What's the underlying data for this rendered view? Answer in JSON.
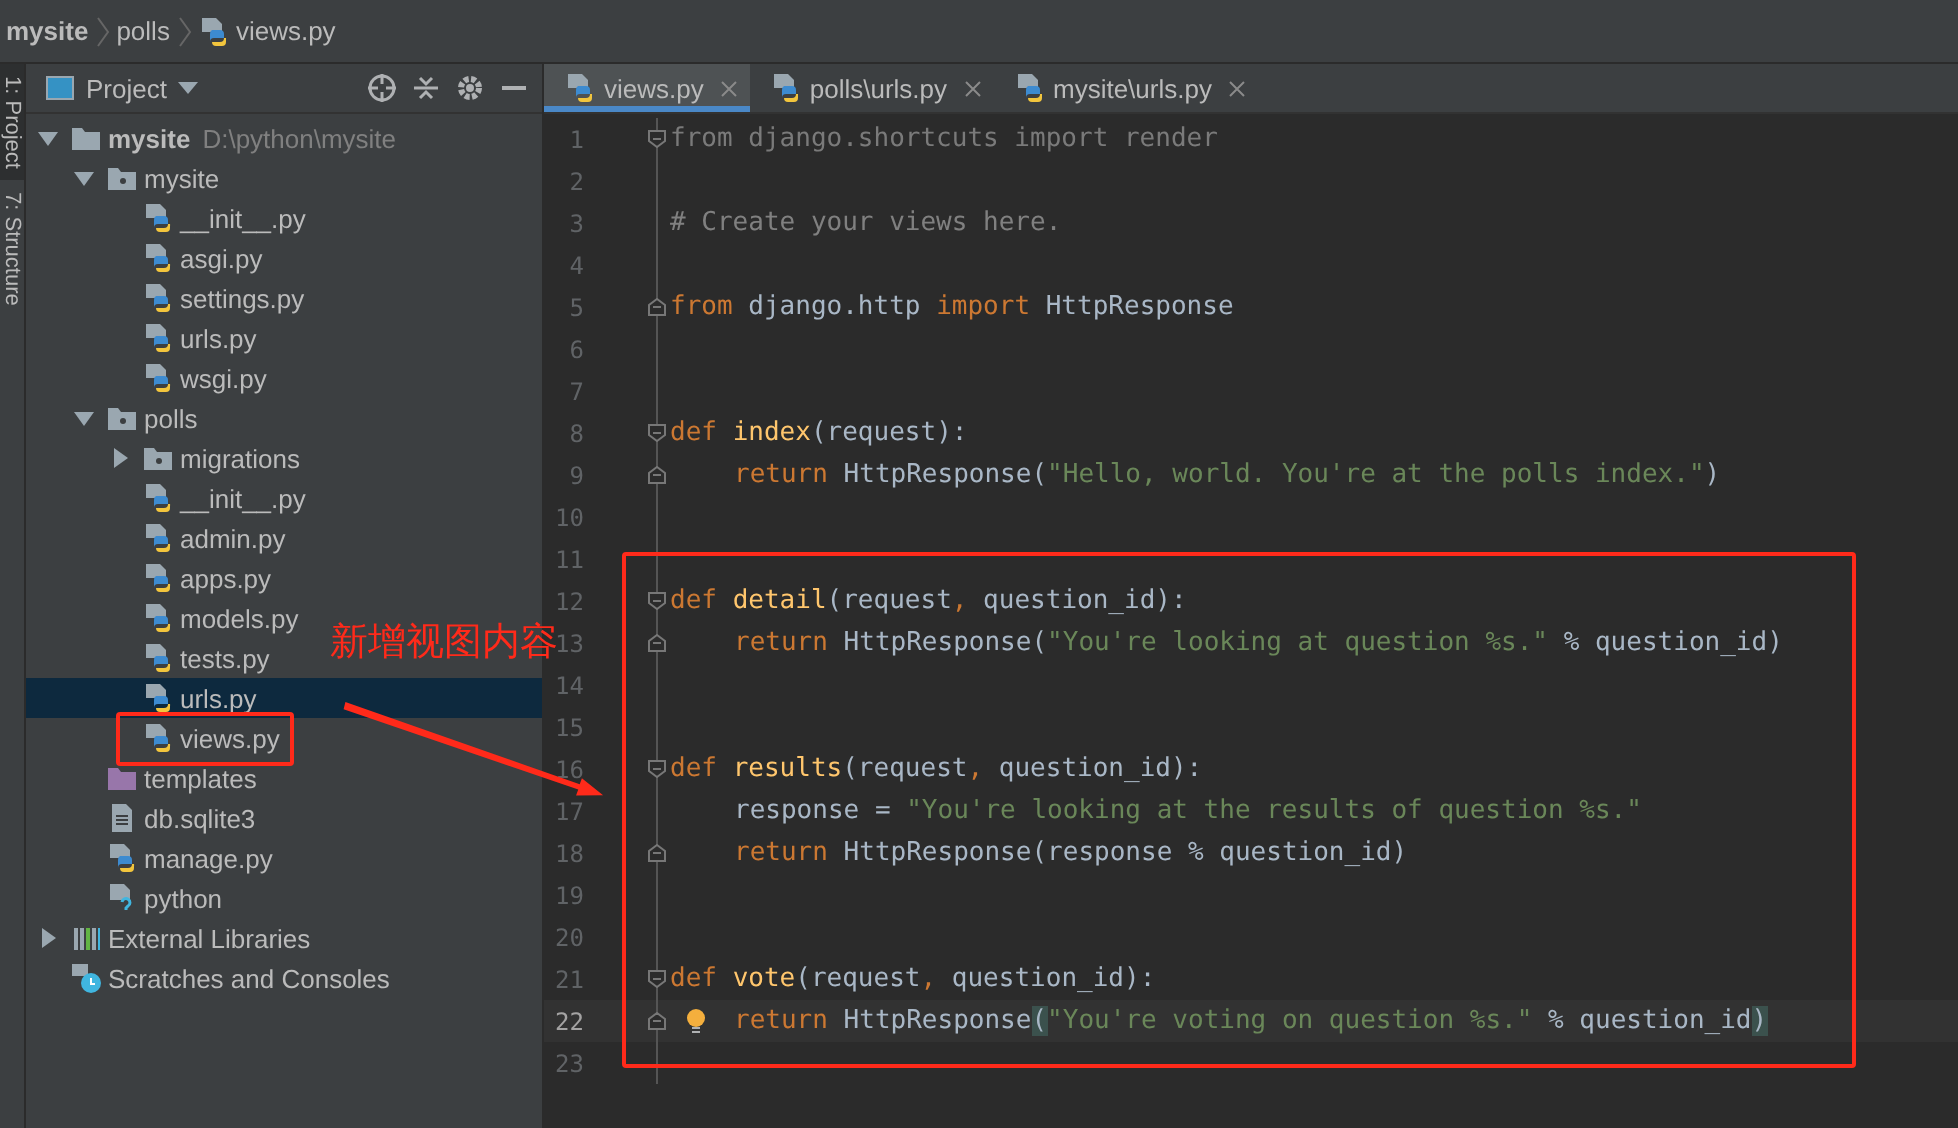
{
  "breadcrumb": [
    {
      "text": "mysite",
      "kind": "project"
    },
    {
      "text": "polls",
      "kind": "folder"
    },
    {
      "text": "views.py",
      "kind": "python"
    }
  ],
  "tool_strip": [
    {
      "label": "1: Project",
      "selected": true
    },
    {
      "label": "7: Structure",
      "selected": false
    }
  ],
  "project_panel": {
    "title": "Project",
    "tree": [
      {
        "name": "mysite",
        "path": "D:\\python\\mysite",
        "kind": "project",
        "expanded": true,
        "selected": false,
        "children": [
          {
            "name": "mysite",
            "kind": "package",
            "expanded": true,
            "selected": false,
            "children": [
              {
                "name": "__init__.py",
                "kind": "python",
                "selected": false
              },
              {
                "name": "asgi.py",
                "kind": "python",
                "selected": false
              },
              {
                "name": "settings.py",
                "kind": "python",
                "selected": false
              },
              {
                "name": "urls.py",
                "kind": "python",
                "selected": false
              },
              {
                "name": "wsgi.py",
                "kind": "python",
                "selected": false
              }
            ]
          },
          {
            "name": "polls",
            "kind": "package",
            "expanded": true,
            "selected": false,
            "children": [
              {
                "name": "migrations",
                "kind": "package",
                "expanded": false,
                "selected": false
              },
              {
                "name": "__init__.py",
                "kind": "python",
                "selected": false
              },
              {
                "name": "admin.py",
                "kind": "python",
                "selected": false
              },
              {
                "name": "apps.py",
                "kind": "python",
                "selected": false
              },
              {
                "name": "models.py",
                "kind": "python",
                "selected": false
              },
              {
                "name": "tests.py",
                "kind": "python",
                "selected": false
              },
              {
                "name": "urls.py",
                "kind": "python",
                "selected": true
              },
              {
                "name": "views.py",
                "kind": "python",
                "selected": false
              }
            ]
          },
          {
            "name": "templates",
            "kind": "templates",
            "selected": false
          },
          {
            "name": "db.sqlite3",
            "kind": "text",
            "selected": false
          },
          {
            "name": "manage.py",
            "kind": "python",
            "selected": false
          },
          {
            "name": "python",
            "kind": "unknown",
            "selected": false
          }
        ]
      },
      {
        "name": "External Libraries",
        "kind": "libraries",
        "expanded": false,
        "selected": false
      },
      {
        "name": "Scratches and Consoles",
        "kind": "scratches",
        "selected": false
      }
    ]
  },
  "tabs": [
    {
      "label": "views.py",
      "selected": true
    },
    {
      "label": "polls\\urls.py",
      "selected": false
    },
    {
      "label": "mysite\\urls.py",
      "selected": false
    }
  ],
  "editor": {
    "lines": [
      {
        "number": "1",
        "fold_start": true,
        "current": false,
        "tokens": [
          {
            "kind": "dim",
            "text": "from django.shortcuts import render"
          }
        ]
      },
      {
        "number": "2",
        "current": false
      },
      {
        "number": "3",
        "current": false,
        "tokens": [
          {
            "kind": "comment",
            "text": "# Create your views here."
          }
        ]
      },
      {
        "number": "4",
        "current": false
      },
      {
        "number": "5",
        "fold_end": true,
        "current": false,
        "tokens": [
          {
            "kind": "keyword",
            "text": "from"
          },
          {
            "kind": "plain",
            "text": " django.http "
          },
          {
            "kind": "keyword",
            "text": "import"
          },
          {
            "kind": "plain",
            "text": " HttpResponse"
          }
        ]
      },
      {
        "number": "6",
        "current": false
      },
      {
        "number": "7",
        "current": false
      },
      {
        "number": "8",
        "fold_start": true,
        "current": false,
        "tokens": [
          {
            "kind": "keyword",
            "text": "def "
          },
          {
            "kind": "func",
            "text": "index"
          },
          {
            "kind": "plain",
            "text": "(request):"
          }
        ]
      },
      {
        "number": "9",
        "fold_end": true,
        "indented": true,
        "current": false,
        "tokens": [
          {
            "kind": "keyword",
            "text": "return"
          },
          {
            "kind": "plain",
            "text": " HttpResponse("
          },
          {
            "kind": "string",
            "text": "\"Hello, world. You're at the polls index.\""
          },
          {
            "kind": "plain",
            "text": ")"
          }
        ]
      },
      {
        "number": "10",
        "current": false
      },
      {
        "number": "11",
        "current": false
      },
      {
        "number": "12",
        "fold_start": true,
        "current": false,
        "tokens": [
          {
            "kind": "keyword",
            "text": "def "
          },
          {
            "kind": "func",
            "text": "detail"
          },
          {
            "kind": "plain",
            "text": "(request"
          },
          {
            "kind": "keyword",
            "text": ","
          },
          {
            "kind": "plain",
            "text": " question_id):"
          }
        ]
      },
      {
        "number": "13",
        "fold_end": true,
        "indented": true,
        "current": false,
        "tokens": [
          {
            "kind": "keyword",
            "text": "return"
          },
          {
            "kind": "plain",
            "text": " HttpResponse("
          },
          {
            "kind": "string",
            "text": "\"You're looking at question %s.\""
          },
          {
            "kind": "plain",
            "text": " % question_id)"
          }
        ]
      },
      {
        "number": "14",
        "current": false
      },
      {
        "number": "15",
        "current": false
      },
      {
        "number": "16",
        "fold_start": true,
        "current": false,
        "tokens": [
          {
            "kind": "keyword",
            "text": "def "
          },
          {
            "kind": "func",
            "text": "results"
          },
          {
            "kind": "plain",
            "text": "(request"
          },
          {
            "kind": "keyword",
            "text": ","
          },
          {
            "kind": "plain",
            "text": " question_id):"
          }
        ]
      },
      {
        "number": "17",
        "indented": true,
        "current": false,
        "tokens": [
          {
            "kind": "plain",
            "text": "response = "
          },
          {
            "kind": "string",
            "text": "\"You're looking at the results of question %s.\""
          }
        ]
      },
      {
        "number": "18",
        "fold_end": true,
        "indented": true,
        "current": false,
        "tokens": [
          {
            "kind": "keyword",
            "text": "return"
          },
          {
            "kind": "plain",
            "text": " HttpResponse(response % question_id)"
          }
        ]
      },
      {
        "number": "19",
        "current": false
      },
      {
        "number": "20",
        "current": false
      },
      {
        "number": "21",
        "fold_start": true,
        "current": false,
        "tokens": [
          {
            "kind": "keyword",
            "text": "def "
          },
          {
            "kind": "func",
            "text": "vote"
          },
          {
            "kind": "plain",
            "text": "(request"
          },
          {
            "kind": "keyword",
            "text": ","
          },
          {
            "kind": "plain",
            "text": " question_id):"
          }
        ]
      },
      {
        "number": "22",
        "fold_end": true,
        "indented": true,
        "current": true,
        "tokens": [
          {
            "kind": "keyword",
            "text": "return"
          },
          {
            "kind": "plain",
            "text": " HttpResponse"
          },
          {
            "kind": "brace",
            "text": "("
          },
          {
            "kind": "string",
            "text": "\"You're voting on question %s.\""
          },
          {
            "kind": "plain",
            "text": " % question_id"
          },
          {
            "kind": "brace",
            "text": ")"
          }
        ]
      },
      {
        "number": "23",
        "current": false
      }
    ]
  },
  "annotation": {
    "note": "新增视图内容"
  }
}
